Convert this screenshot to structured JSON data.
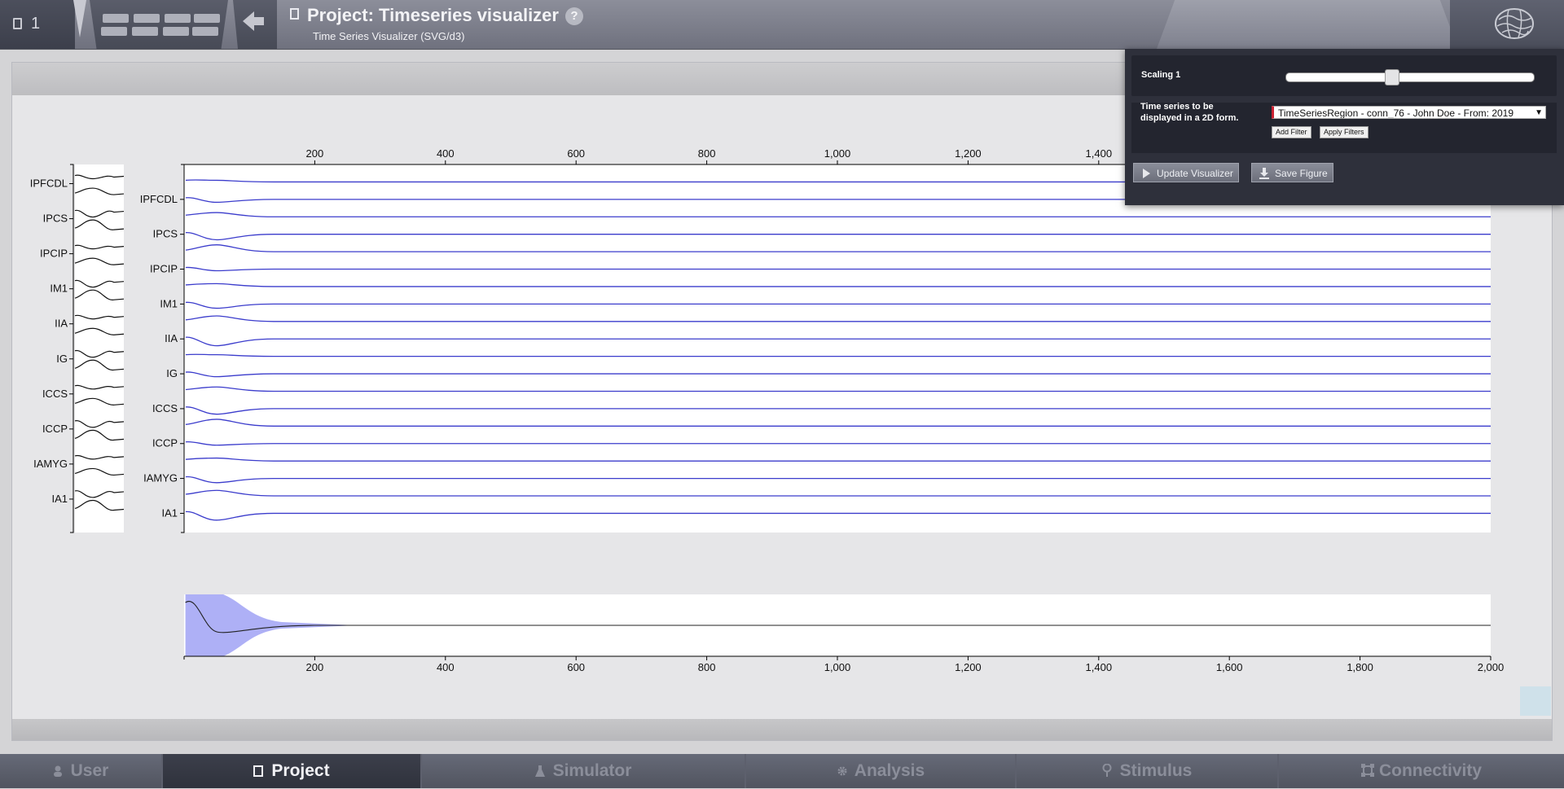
{
  "header": {
    "counter": "1",
    "project_title": "Project: Timeseries visualizer",
    "help": "?",
    "subtitle": "Time Series Visualizer (SVG/d3)"
  },
  "controls": {
    "scaling_label": "Scaling 1",
    "scaling_value": 0.42,
    "timeseries_label": "Time series to be displayed in a 2D form.",
    "timeseries_selected": "TimeSeriesRegion - conn_76 - John Doe - From: 2019",
    "add_filter": "Add Filter",
    "apply_filters": "Apply Filters",
    "update_visualizer": "Update Visualizer",
    "save_figure": "Save Figure"
  },
  "tabs": [
    {
      "label": "User",
      "icon": "user-icon",
      "active": false
    },
    {
      "label": "Project",
      "icon": "document-icon",
      "active": true
    },
    {
      "label": "Simulator",
      "icon": "flask-icon",
      "active": false
    },
    {
      "label": "Analysis",
      "icon": "gear-icon",
      "active": false
    },
    {
      "label": "Stimulus",
      "icon": "pin-icon",
      "active": false
    },
    {
      "label": "Connectivity",
      "icon": "network-icon",
      "active": false
    }
  ],
  "colors": {
    "trace": "#3b3ccc",
    "band": "#aeb0f6"
  },
  "chart_data": [
    {
      "type": "line",
      "role": "overview",
      "channel_labels": [
        "IPFCDL",
        "IPCS",
        "IPCIP",
        "IM1",
        "IIA",
        "IG",
        "ICCS",
        "ICCP",
        "IAMYG",
        "IA1"
      ],
      "channel_count": 20
    },
    {
      "type": "line",
      "role": "main",
      "channel_labels": [
        "IPFCDL",
        "IPCS",
        "IPCIP",
        "IM1",
        "IIA",
        "IG",
        "ICCS",
        "ICCP",
        "IAMYG",
        "IA1"
      ],
      "channel_count": 20,
      "x_ticks": [
        "200",
        "400",
        "600",
        "800",
        "1,000",
        "1,200",
        "1,400"
      ],
      "xlim": [
        0,
        2000
      ]
    },
    {
      "type": "area",
      "role": "context",
      "x_ticks": [
        "200",
        "400",
        "600",
        "800",
        "1,000",
        "1,200",
        "1,400",
        "1,600",
        "1,800",
        "2,000"
      ],
      "xlim": [
        0,
        2000
      ]
    }
  ]
}
